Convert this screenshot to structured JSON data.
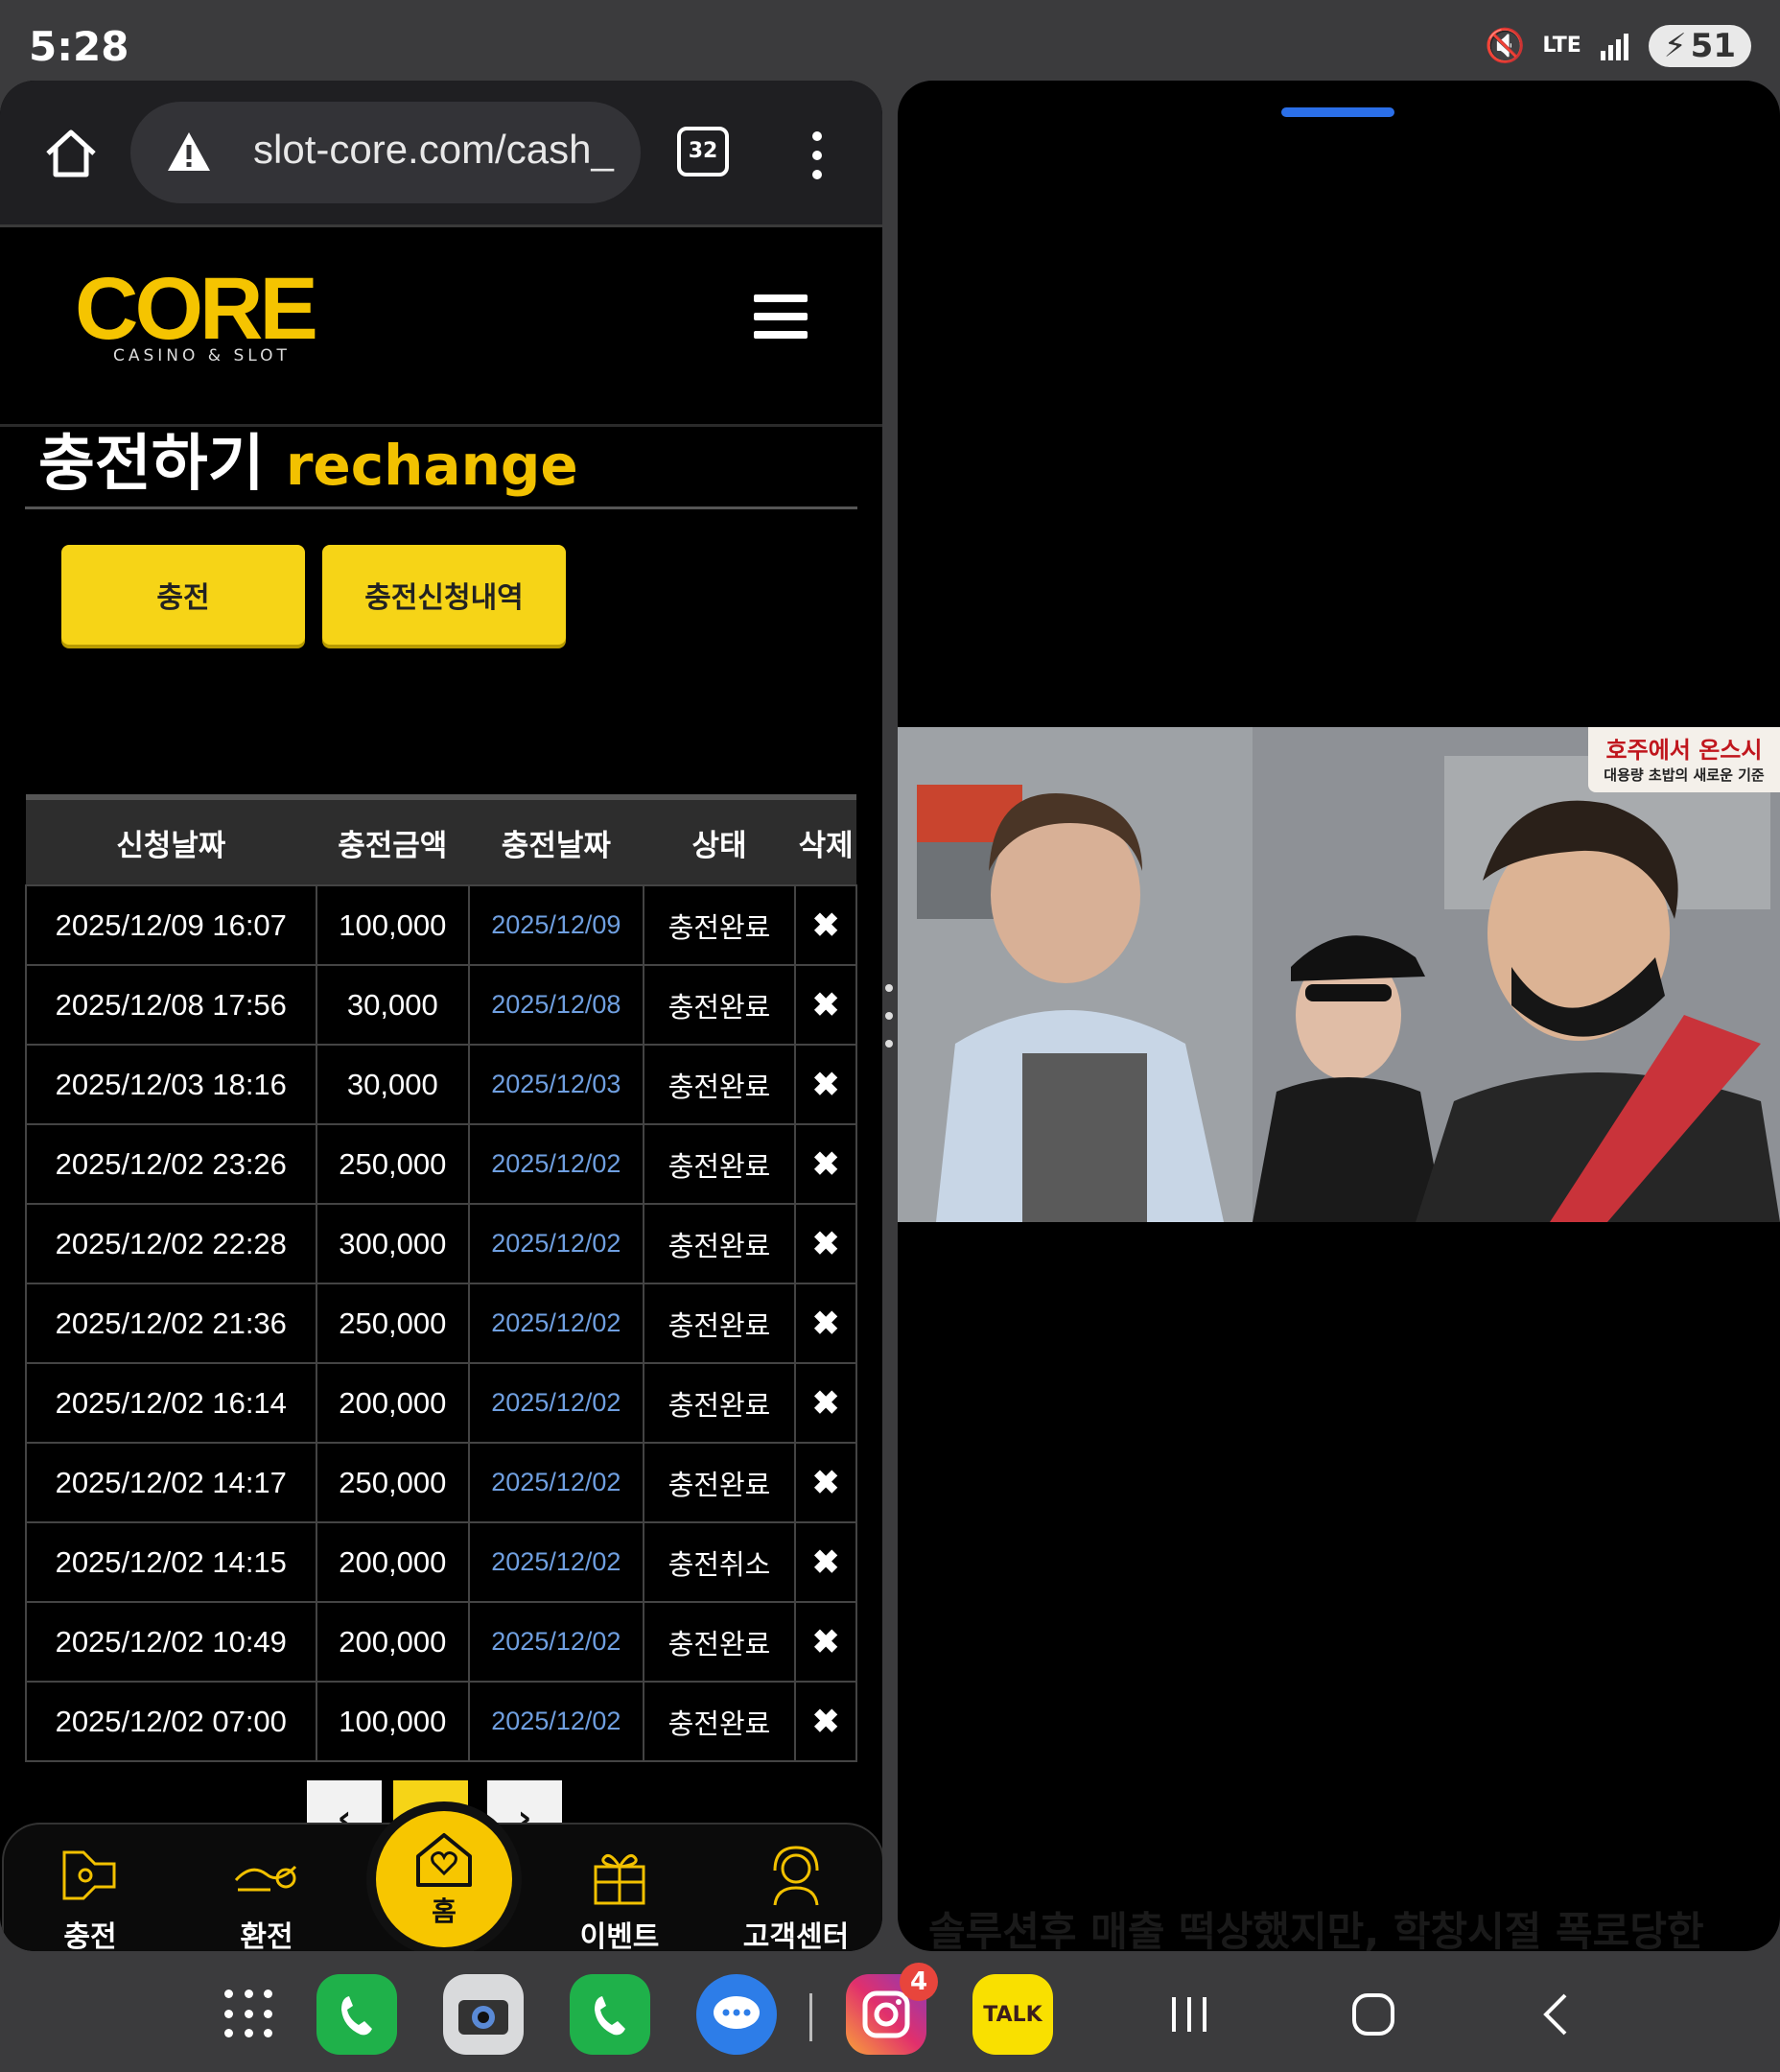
{
  "status_bar": {
    "time": "5:28",
    "network": "LTE",
    "battery": "51"
  },
  "browser": {
    "url": "slot-core.com/cash_",
    "tab_count": "32"
  },
  "site": {
    "logo_text": "CORE",
    "logo_sub": "CASINO & SLOT"
  },
  "page": {
    "title_ko": "충전하기",
    "title_en": "rechange"
  },
  "tabs": {
    "charge": "충전",
    "history": "충전신청내역"
  },
  "table": {
    "headers": [
      "신청날짜",
      "충전금액",
      "충전날짜",
      "상태",
      "삭제"
    ],
    "rows": [
      {
        "req_date": "2025/12/09 16:07",
        "amount": "100,000",
        "charge_date": "2025/12/09",
        "status": "충전완료",
        "delete": "✖"
      },
      {
        "req_date": "2025/12/08 17:56",
        "amount": "30,000",
        "charge_date": "2025/12/08",
        "status": "충전완료",
        "delete": "✖"
      },
      {
        "req_date": "2025/12/03 18:16",
        "amount": "30,000",
        "charge_date": "2025/12/03",
        "status": "충전완료",
        "delete": "✖"
      },
      {
        "req_date": "2025/12/02 23:26",
        "amount": "250,000",
        "charge_date": "2025/12/02",
        "status": "충전완료",
        "delete": "✖"
      },
      {
        "req_date": "2025/12/02 22:28",
        "amount": "300,000",
        "charge_date": "2025/12/02",
        "status": "충전완료",
        "delete": "✖"
      },
      {
        "req_date": "2025/12/02 21:36",
        "amount": "250,000",
        "charge_date": "2025/12/02",
        "status": "충전완료",
        "delete": "✖"
      },
      {
        "req_date": "2025/12/02 16:14",
        "amount": "200,000",
        "charge_date": "2025/12/02",
        "status": "충전완료",
        "delete": "✖"
      },
      {
        "req_date": "2025/12/02 14:17",
        "amount": "250,000",
        "charge_date": "2025/12/02",
        "status": "충전완료",
        "delete": "✖"
      },
      {
        "req_date": "2025/12/02 14:15",
        "amount": "200,000",
        "charge_date": "2025/12/02",
        "status": "충전취소",
        "delete": "✖"
      },
      {
        "req_date": "2025/12/02 10:49",
        "amount": "200,000",
        "charge_date": "2025/12/02",
        "status": "충전완료",
        "delete": "✖"
      },
      {
        "req_date": "2025/12/02 07:00",
        "amount": "100,000",
        "charge_date": "2025/12/02",
        "status": "충전완료",
        "delete": "✖"
      }
    ]
  },
  "pagination": {
    "prev": "‹",
    "current": "1",
    "next": "›"
  },
  "bottom_nav": {
    "charge": "충전",
    "exchange": "환전",
    "home": "홈",
    "event": "이벤트",
    "support": "고객센터"
  },
  "video": {
    "badge_top": "호주에서 온스시",
    "badge_bottom": "대용량 초밥의 새로운 기준",
    "subtitle": "솔루션후 매출 떡상했지만, 학창시절 폭로당한"
  },
  "taskbar": {
    "instagram_badge": "4",
    "kakao_label": "TALK"
  },
  "colors": {
    "accent_yellow": "#f6d417",
    "link_blue": "#6f9fe0",
    "background": "#000000"
  }
}
